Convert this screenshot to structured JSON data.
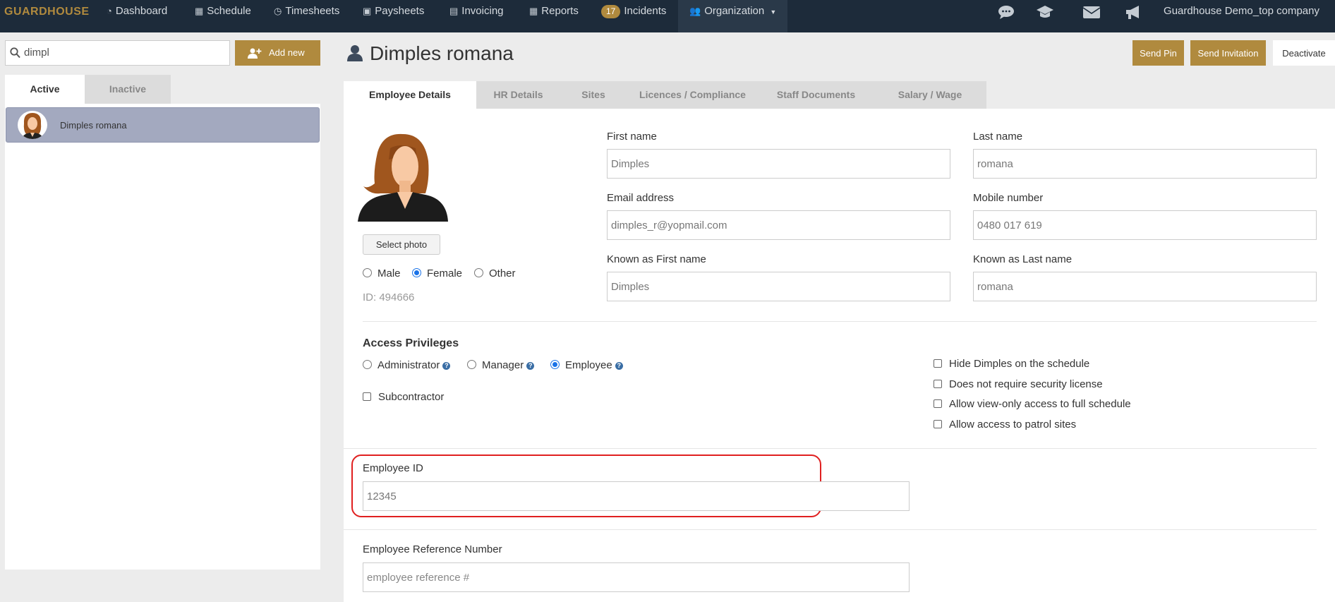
{
  "nav": {
    "brand": "GUARDHOUSE",
    "items": [
      {
        "label": "Dashboard",
        "icon": "dashboard-icon"
      },
      {
        "label": "Schedule",
        "icon": "calendar-icon"
      },
      {
        "label": "Timesheets",
        "icon": "clock-icon"
      },
      {
        "label": "Paysheets",
        "icon": "money-icon"
      },
      {
        "label": "Invoicing",
        "icon": "invoice-icon"
      },
      {
        "label": "Reports",
        "icon": "table-icon"
      },
      {
        "label": "Incidents",
        "badge": "17"
      },
      {
        "label": "Organization",
        "icon": "users-icon"
      }
    ],
    "company": "Guardhouse Demo_top company",
    "accent": "#b08a3e",
    "bg": "#1d2b3a"
  },
  "left": {
    "search_value": "dimpl",
    "add_new": "Add new",
    "tabs": {
      "active": "Active",
      "inactive": "Inactive"
    },
    "employees": [
      {
        "name": "Dimples romana"
      }
    ]
  },
  "header": {
    "title": "Dimples romana",
    "send_pin": "Send Pin",
    "send_invitation": "Send Invitation",
    "deactivate": "Deactivate"
  },
  "tabs": [
    "Employee Details",
    "HR Details",
    "Sites",
    "Licences / Compliance",
    "Staff Documents",
    "Salary / Wage"
  ],
  "details": {
    "select_photo": "Select photo",
    "gender": {
      "male": "Male",
      "female": "Female",
      "other": "Other",
      "selected": "Female"
    },
    "id_text": "ID: 494666",
    "first_name_label": "First name",
    "first_name": "Dimples",
    "last_name_label": "Last name",
    "last_name": "romana",
    "email_label": "Email address",
    "email": "dimples_r@yopmail.com",
    "mobile_label": "Mobile number",
    "mobile": "0480 017 619",
    "known_first_label": "Known as First name",
    "known_first": "Dimples",
    "known_last_label": "Known as Last name",
    "known_last": "romana"
  },
  "access": {
    "title": "Access Privileges",
    "administrator": "Administrator",
    "manager": "Manager",
    "employee": "Employee",
    "selected": "Employee",
    "subcontractor": "Subcontractor",
    "options": [
      "Hide Dimples on the schedule",
      "Does not require security license",
      "Allow view-only access to full schedule",
      "Allow access to patrol sites"
    ]
  },
  "employee_id": {
    "label": "Employee ID",
    "value": "12345"
  },
  "reference": {
    "label": "Employee Reference Number",
    "placeholder": "employee reference #"
  }
}
